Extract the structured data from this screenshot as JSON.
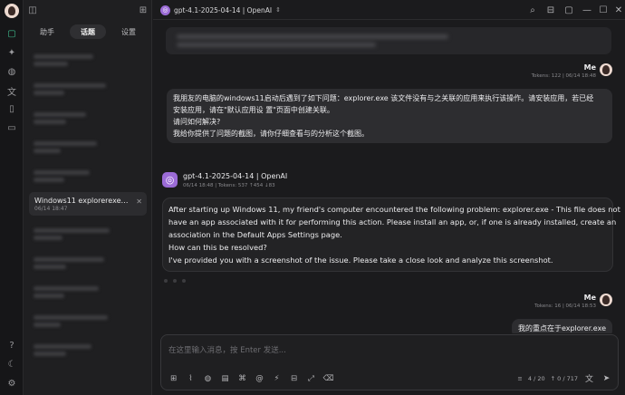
{
  "sidebar": {
    "tabs": [
      {
        "label": "助手",
        "active": false
      },
      {
        "label": "话题",
        "active": true
      },
      {
        "label": "设置",
        "active": false
      }
    ],
    "active_topic": {
      "title": "Windows11 explorerexe关联错...",
      "date": "06/14 18:47"
    }
  },
  "header": {
    "model_label": "gpt-4.1-2025-04-14 | OpenAI"
  },
  "messages": {
    "user1": {
      "name": "Me",
      "meta": "Tokens: 122 | 06/14 18:48",
      "lines": [
        "我朋友的电脑的windows11启动后遇到了如下问题：explorer.exe 该文件没有与之关联的应用来执行该操作。请安装应用，若已经",
        "安装应用，请在\"默认应用设 置\"页面中创建关联。",
        "请问如何解决?",
        "我给你提供了问题的截图，请你仔细查看与的分析这个截图。"
      ]
    },
    "ai1": {
      "name": "gpt-4.1-2025-04-14 | OpenAI",
      "meta": "06/14 18:48 | Tokens: 537 ↑454 ↓83",
      "lines": [
        "After starting up Windows 11, my friend's computer encountered the following problem: explorer.exe - This file does not",
        "have an app associated with it for performing this action. Please install an app, or, if one is already installed, create an",
        "association in the Default Apps Settings page.",
        "How can this be resolved?",
        "I've provided you with a screenshot of the issue. Please take a close look and analyze this screenshot."
      ]
    },
    "user2": {
      "name": "Me",
      "meta": "Tokens: 16 | 06/14 18:53",
      "text": "我的重点在于explorer.exe"
    }
  },
  "composer": {
    "placeholder": "在这里输入消息，按 Enter 发送...",
    "context_count": "4 / 20",
    "token_count": "↑ 0 / 717"
  },
  "colors": {
    "accent_green": "#3fbf8f",
    "openai_purple": "#9b6bd6"
  }
}
